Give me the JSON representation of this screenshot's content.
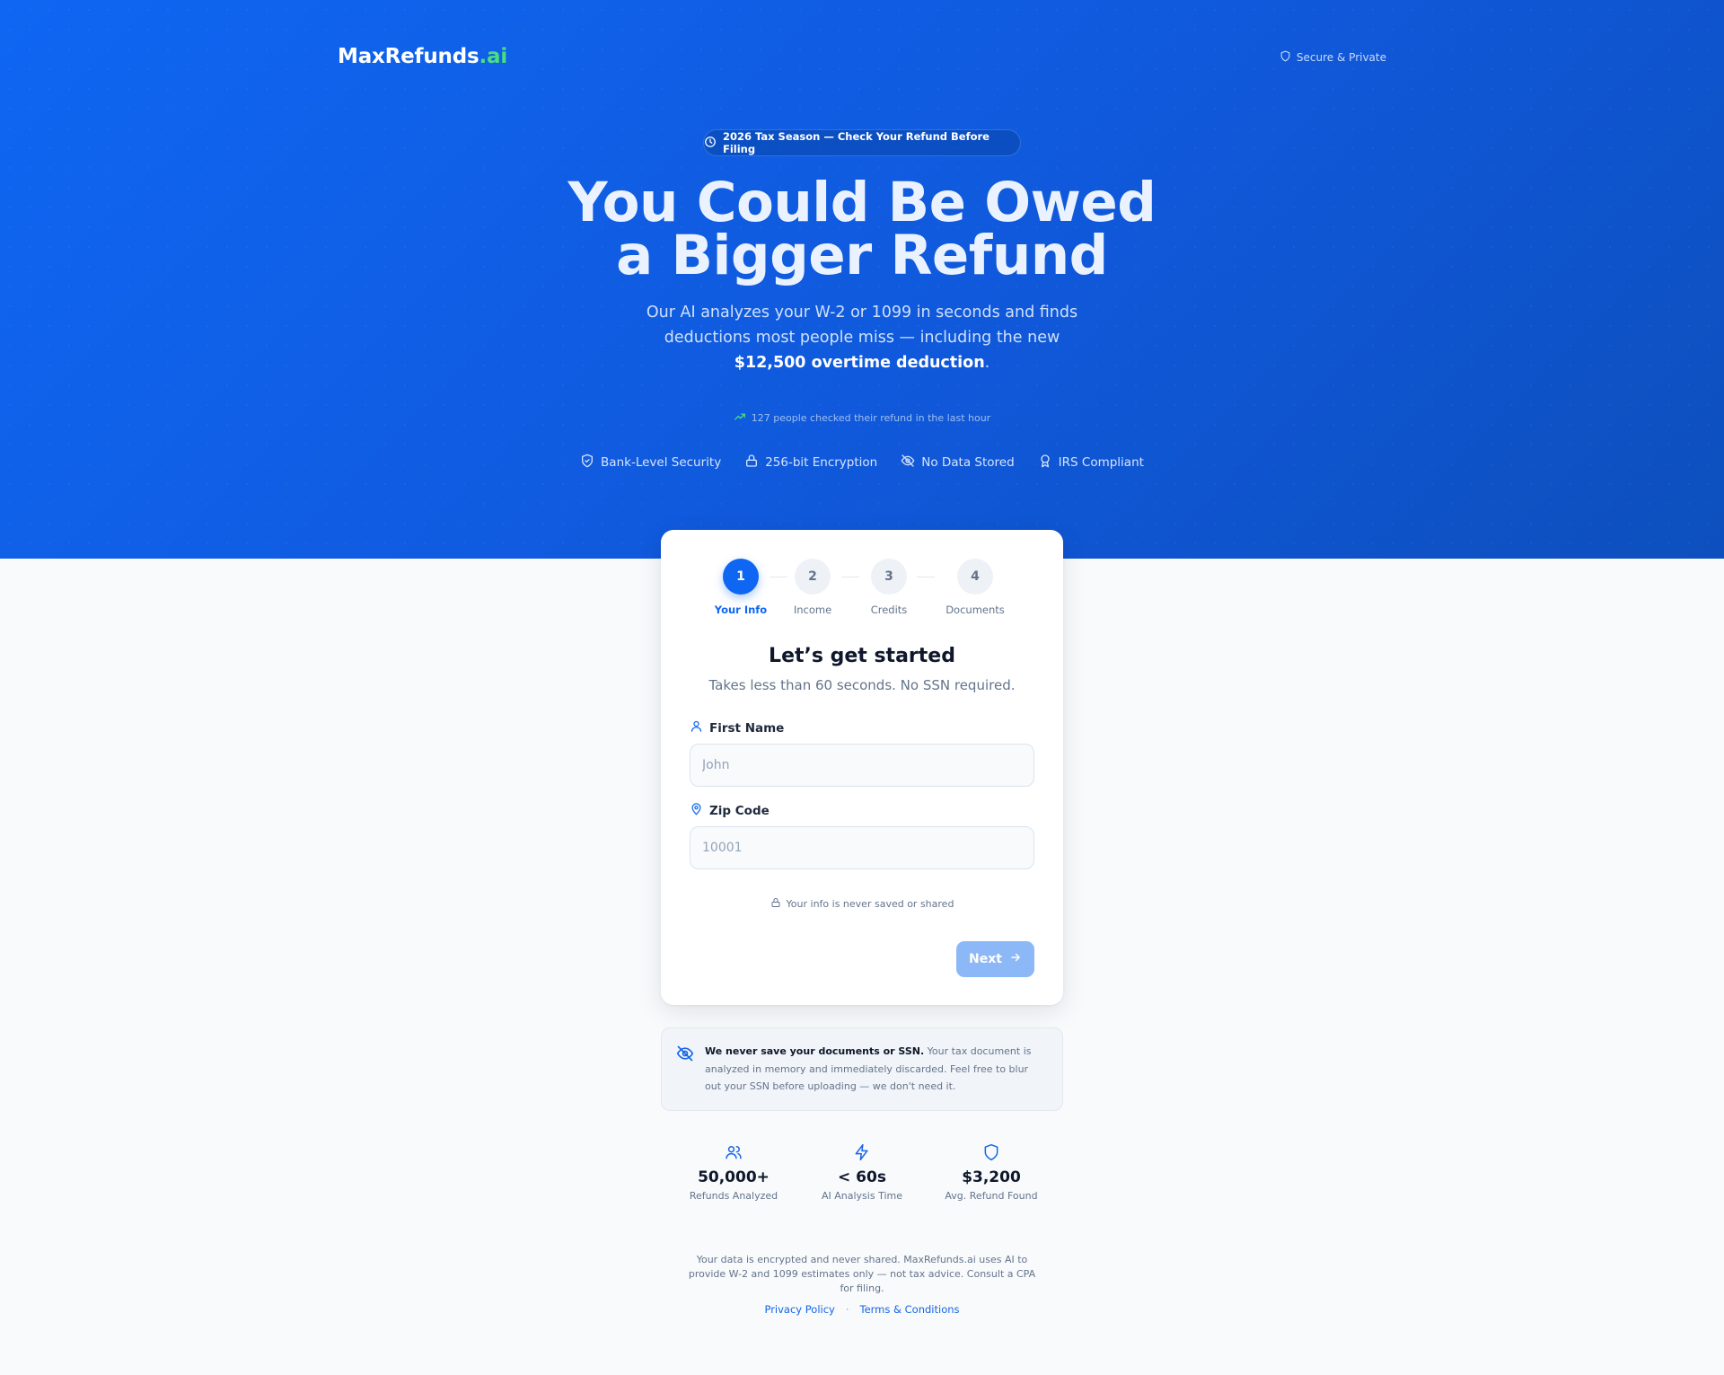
{
  "brand": {
    "name": "MaxRefunds",
    "tld": ".ai"
  },
  "header": {
    "secure_label": "Secure & Private"
  },
  "hero": {
    "season_pill": "2026 Tax Season — Check Your Refund Before Filing",
    "headline_line1": "You Could Be Owed",
    "headline_line2": "a Bigger Refund",
    "subhead_prefix": "Our AI analyzes your W-2 or 1099 in seconds and finds deductions most people miss — including the new ",
    "subhead_bold": "$12,500 overtime deduction",
    "subhead_suffix": ".",
    "live_count": "127 people checked their refund in the last hour",
    "trust": [
      {
        "icon": "shield-check-icon",
        "label": "Bank-Level Security"
      },
      {
        "icon": "lock-icon",
        "label": "256-bit Encryption"
      },
      {
        "icon": "eye-off-icon",
        "label": "No Data Stored"
      },
      {
        "icon": "award-icon",
        "label": "IRS Compliant"
      }
    ]
  },
  "stepper": {
    "steps": [
      {
        "number": "1",
        "label": "Your Info",
        "active": true
      },
      {
        "number": "2",
        "label": "Income",
        "active": false
      },
      {
        "number": "3",
        "label": "Credits",
        "active": false
      },
      {
        "number": "4",
        "label": "Documents",
        "active": false
      }
    ]
  },
  "form": {
    "title": "Let’s get started",
    "subtitle": "Takes less than 60 seconds. No SSN required.",
    "first_name": {
      "label": "First Name",
      "placeholder": "John",
      "value": ""
    },
    "zip_code": {
      "label": "Zip Code",
      "placeholder": "10001",
      "value": ""
    },
    "privacy_note": "Your info is never saved or shared",
    "next_label": "Next"
  },
  "privacy_box": {
    "bold": "We never save your documents or SSN.",
    "text": " Your tax document is analyzed in memory and immediately discarded. Feel free to blur out your SSN before uploading — we don't need it."
  },
  "stats": [
    {
      "icon": "users-icon",
      "value": "50,000+",
      "label": "Refunds Analyzed"
    },
    {
      "icon": "zap-icon",
      "value": "< 60s",
      "label": "AI Analysis Time"
    },
    {
      "icon": "shield-icon",
      "value": "$3,200",
      "label": "Avg. Refund Found"
    }
  ],
  "footer": {
    "disclaimer": "Your data is encrypted and never shared. MaxRefunds.ai uses AI to provide W-2 and 1099 estimates only — not tax advice. Consult a CPA for filing.",
    "privacy_link": "Privacy Policy",
    "separator": "·",
    "terms_link": "Terms & Conditions"
  },
  "colors": {
    "brand_blue": "#0f66f2",
    "brand_green": "#4ade80",
    "button_disabled": "#8db8f7"
  }
}
